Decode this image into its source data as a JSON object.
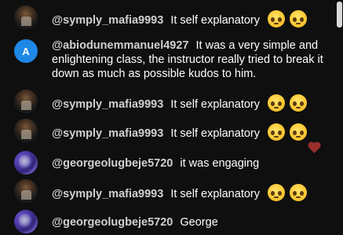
{
  "messages": [
    {
      "author": "@symply_mafia9993",
      "text": "It self explanatory",
      "emoji": [
        "pleading-face",
        "pleading-face"
      ],
      "avatar": "photo-dark"
    },
    {
      "author": "@abiodunemmanuel4927",
      "text": "It was a very simple and enlightening class, the instructor really tried to break it down as much as possible kudos to him.",
      "avatar_letter": "A",
      "avatar_color": "#1e88e5"
    },
    {
      "author": "@symply_mafia9993",
      "text": "It self explanatory",
      "emoji": [
        "pleading-face",
        "pleading-face"
      ],
      "avatar": "photo-dark"
    },
    {
      "author": "@symply_mafia9993",
      "text": "It self explanatory",
      "emoji": [
        "pleading-face",
        "pleading-face"
      ],
      "avatar": "photo-dark"
    },
    {
      "author": "@georgeolugbeje5720",
      "text": "it was engaging",
      "avatar": "photo-purple"
    },
    {
      "author": "@symply_mafia9993",
      "text": "It self explanatory",
      "emoji": [
        "pleading-face",
        "pleading-face"
      ],
      "avatar": "photo-dark"
    },
    {
      "author": "@georgeolugbeje5720",
      "text": "George",
      "avatar": "photo-purple"
    }
  ],
  "reaction_icon": "heart-icon",
  "colors": {
    "background": "#0f0f0f",
    "author": "#d0d0d0",
    "text": "#ffffff",
    "reaction": "#a83232"
  }
}
